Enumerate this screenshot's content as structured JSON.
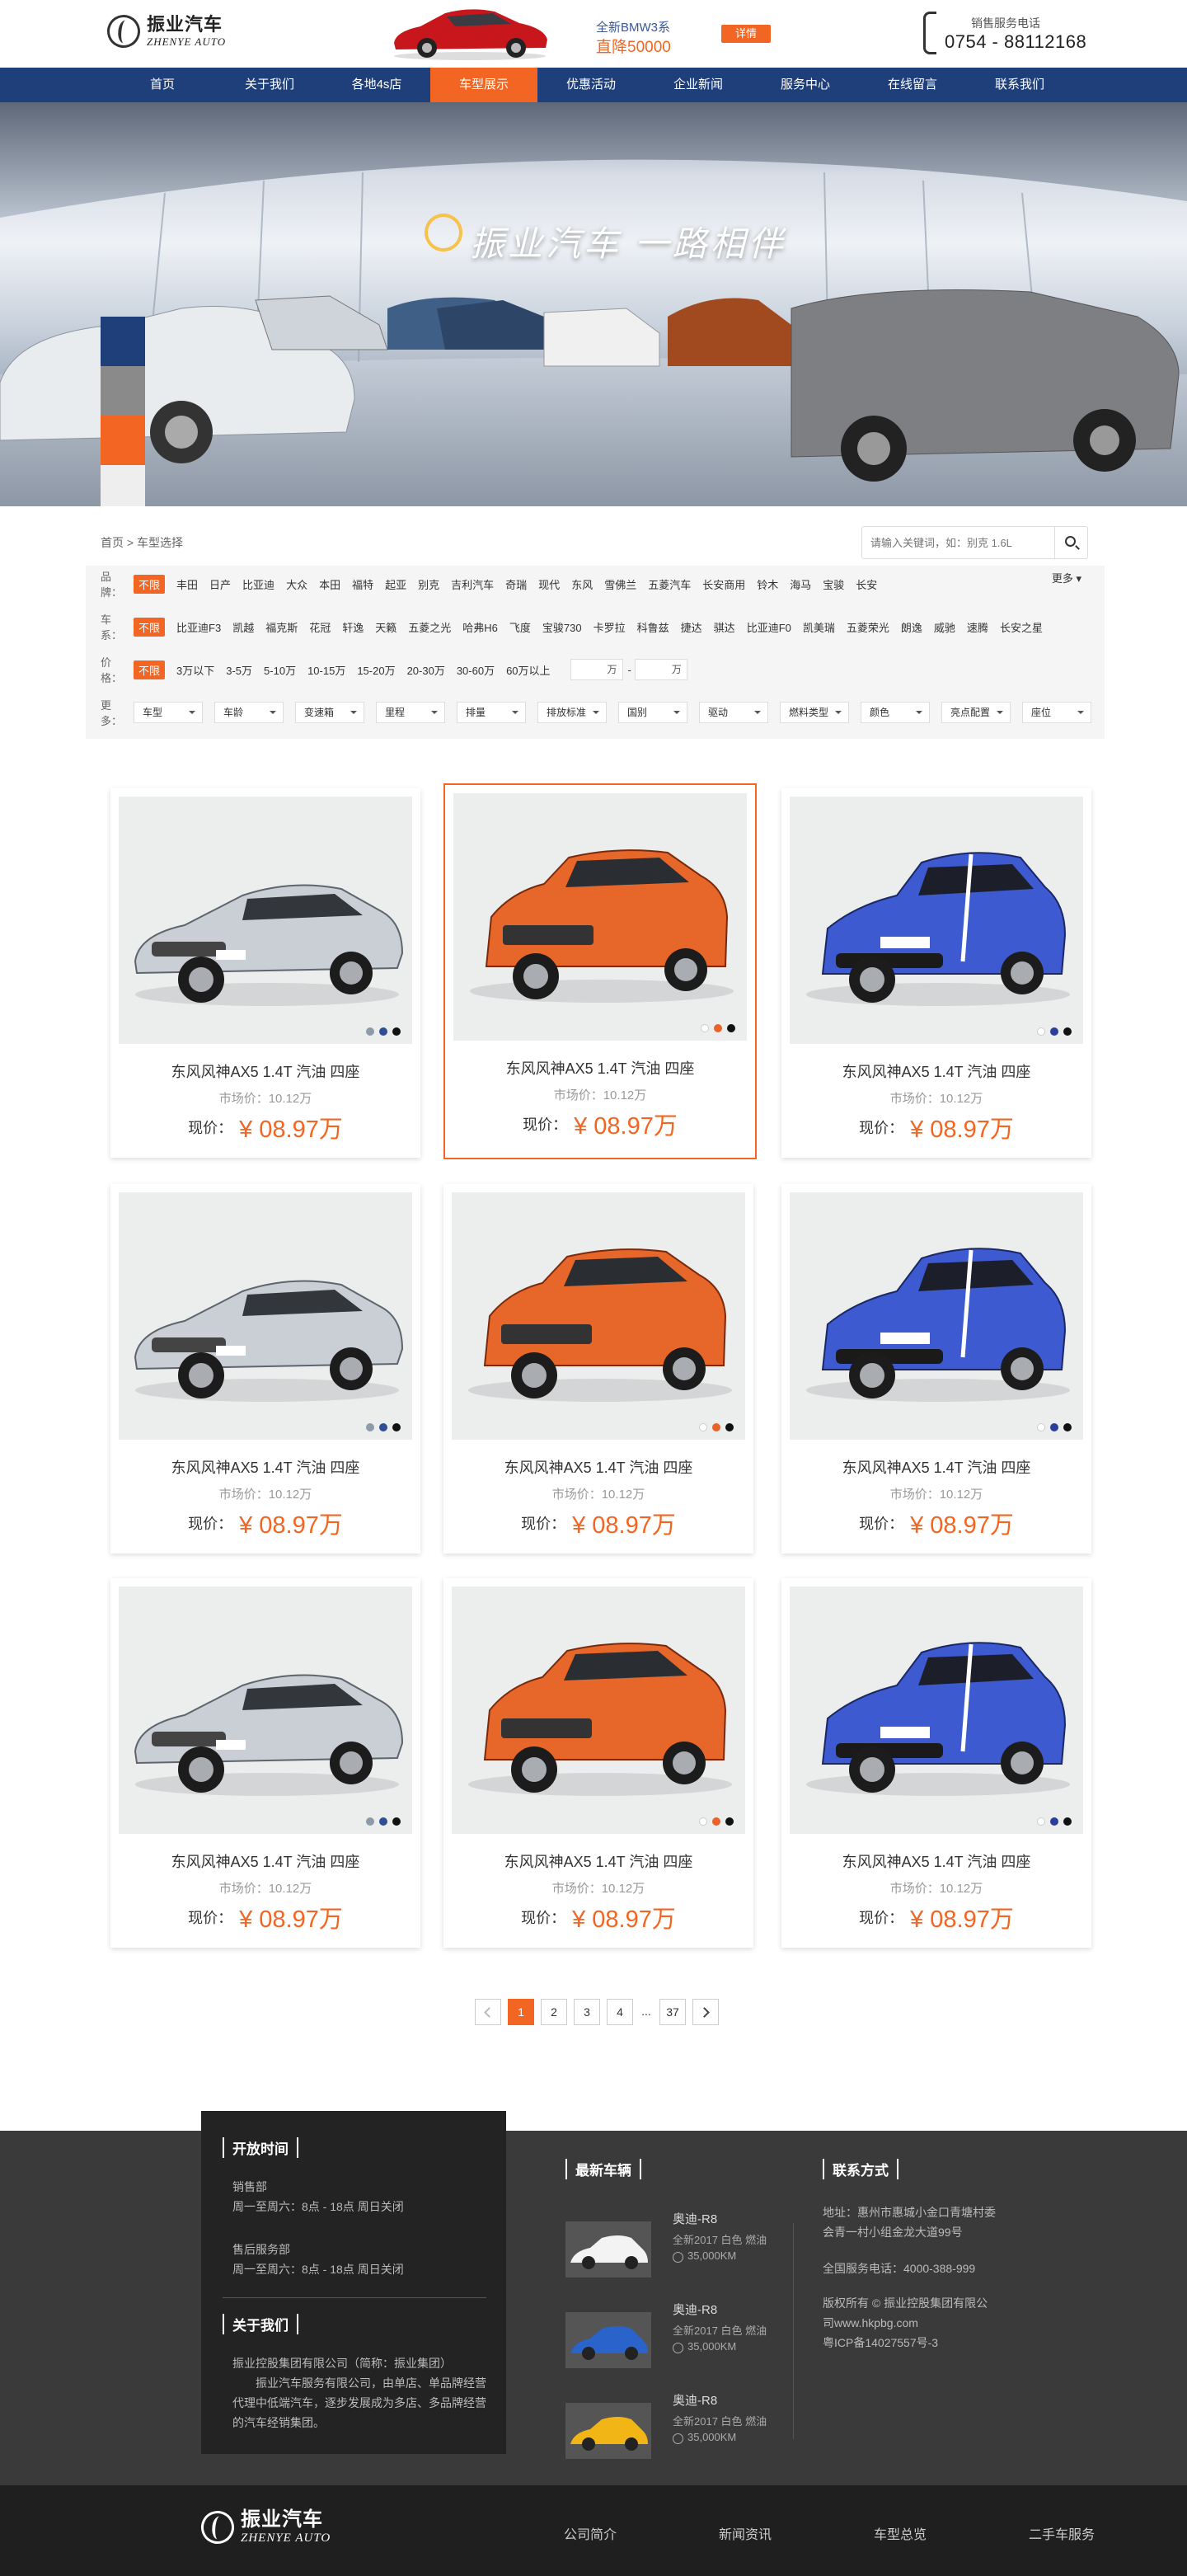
{
  "brand": {
    "name_cn": "振业汽车",
    "name_en": "ZHENYE AUTO"
  },
  "ad": {
    "line1": "全新BMW3系",
    "line2": "直降50000",
    "button": "详情"
  },
  "hotline": {
    "label": "销售服务电话",
    "number": "0754 - 88112168"
  },
  "nav": [
    "首页",
    "关于我们",
    "各地4s店",
    "车型展示",
    "优惠活动",
    "企业新闻",
    "服务中心",
    "在线留言",
    "联系我们"
  ],
  "nav_active_index": 3,
  "banner": {
    "slogan": "振业汽车  一路相伴"
  },
  "breadcrumb": "首页 > 车型选择",
  "search": {
    "placeholder": "请输入关键词，如：别克 1.6L"
  },
  "filters": {
    "brand": {
      "label": "品 牌：",
      "options": [
        "不限",
        "丰田",
        "日产",
        "比亚迪",
        "大众",
        "本田",
        "福特",
        "起亚",
        "别克",
        "吉利汽车",
        "奇瑞",
        "现代",
        "东风",
        "雪佛兰",
        "五菱汽车",
        "长安商用",
        "铃木",
        "海马",
        "宝骏",
        "长安"
      ],
      "more": "更多"
    },
    "series": {
      "label": "车 系：",
      "options": [
        "不限",
        "比亚迪F3",
        "凯越",
        "福克斯",
        "花冠",
        "轩逸",
        "天籁",
        "五菱之光",
        "哈弗H6",
        "飞度",
        "宝骏730",
        "卡罗拉",
        "科鲁兹",
        "捷达",
        "骐达",
        "比亚迪F0",
        "凯美瑞",
        "五菱荣光",
        "朗逸",
        "威驰",
        "速腾",
        "长安之星"
      ]
    },
    "price": {
      "label": "价 格：",
      "options": [
        "不限",
        "3万以下",
        "3-5万",
        "5-10万",
        "10-15万",
        "15-20万",
        "20-30万",
        "30-60万",
        "60万以上"
      ],
      "from_unit": "万",
      "to_unit": "万",
      "dash": "-"
    },
    "more": {
      "label": "更 多：",
      "dropdowns": [
        "车型",
        "车龄",
        "变速箱",
        "里程",
        "排量",
        "排放标准",
        "国别",
        "驱动",
        "燃料类型",
        "颜色",
        "亮点配置",
        "座位"
      ]
    }
  },
  "products": [
    {
      "name": "东风风神AX5   1.4T 汽油 四座",
      "market": "市场价：10.12万",
      "price_label": "现价：",
      "price": "¥ 08.97万",
      "car": "silver"
    },
    {
      "name": "东风风神AX5   1.4T 汽油 四座",
      "market": "市场价：10.12万",
      "price_label": "现价：",
      "price": "¥ 08.97万",
      "car": "orange"
    },
    {
      "name": "东风风神AX5   1.4T 汽油 四座",
      "market": "市场价：10.12万",
      "price_label": "现价：",
      "price": "¥ 08.97万",
      "car": "blue"
    },
    {
      "name": "东风风神AX5   1.4T 汽油 四座",
      "market": "市场价：10.12万",
      "price_label": "现价：",
      "price": "¥ 08.97万",
      "car": "silver"
    },
    {
      "name": "东风风神AX5   1.4T 汽油 四座",
      "market": "市场价：10.12万",
      "price_label": "现价：",
      "price": "¥ 08.97万",
      "car": "orange"
    },
    {
      "name": "东风风神AX5   1.4T 汽油 四座",
      "market": "市场价：10.12万",
      "price_label": "现价：",
      "price": "¥ 08.97万",
      "car": "blue"
    },
    {
      "name": "东风风神AX5   1.4T 汽油 四座",
      "market": "市场价：10.12万",
      "price_label": "现价：",
      "price": "¥ 08.97万",
      "car": "silver"
    },
    {
      "name": "东风风神AX5   1.4T 汽油 四座",
      "market": "市场价：10.12万",
      "price_label": "现价：",
      "price": "¥ 08.97万",
      "car": "orange"
    },
    {
      "name": "东风风神AX5   1.4T 汽油 四座",
      "market": "市场价：10.12万",
      "price_label": "现价：",
      "price": "¥ 08.97万",
      "car": "blue"
    }
  ],
  "pagination": {
    "pages": [
      "1",
      "2",
      "3",
      "4",
      "...",
      "37"
    ],
    "current": "1"
  },
  "footer": {
    "hours_title": "开放时间",
    "sales_dept": "销售部",
    "sales_hours": "周一至周六：8点 - 18点   周日关闭",
    "service_dept": "售后服务部",
    "service_hours": "周一至周六：8点 - 18点   周日关闭",
    "about_title": "关于我们",
    "about_company": "振业控股集团有限公司（简称：振业集团）",
    "about_text": "振业汽车服务有限公司，由单店、单品牌经营代理中低端汽车，逐步发展成为多店、多品牌经营的汽车经销集团。",
    "news_title": "最新车辆",
    "news": [
      {
        "title": "奥迪-R8",
        "sub": "全新2017 白色 燃油",
        "km": "35,000KM"
      },
      {
        "title": "奥迪-R8",
        "sub": "全新2017 白色 燃油",
        "km": "35,000KM"
      },
      {
        "title": "奥迪-R8",
        "sub": "全新2017 白色 燃油",
        "km": "35,000KM"
      }
    ],
    "contact_title": "联系方式",
    "address": "地址：惠州市惠城小金口青塘村委会青一村小组金龙大道99号",
    "phone": "全国服务电话：4000-388-999",
    "copyright": "版权所有 © 振业控股集团有限公司www.hkpbg.com",
    "icp": "粤ICP备14027557号-3"
  },
  "bottom_links": [
    "公司简介",
    "新闻资讯",
    "车型总览",
    "二手车服务"
  ],
  "colors": {
    "accent": "#f26522",
    "nav": "#1e3f7a",
    "footer": "#3a3a3a",
    "footer_dark": "#232323"
  }
}
